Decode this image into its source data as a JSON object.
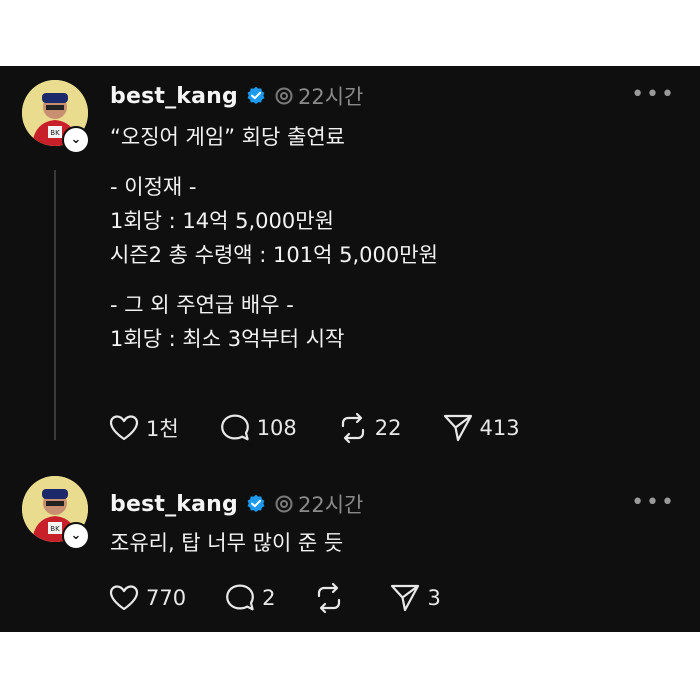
{
  "posts": [
    {
      "username": "best_kang",
      "time": "22시간",
      "text_lines": [
        "“오징어 게임” 회당 출연료",
        "",
        "- 이정재 -",
        "1회당 : 14억 5,000만원",
        "시즌2 총 수령액 : 101억 5,000만원",
        "",
        "- 그 외 주연급 배우 -",
        "1회당 : 최소 3억부터 시작"
      ],
      "likes": "1천",
      "comments": "108",
      "reposts": "22",
      "shares": "413"
    },
    {
      "username": "best_kang",
      "time": "22시간",
      "text_lines": [
        "조유리, 탑 너무 많이 준 듯"
      ],
      "likes": "770",
      "comments": "2",
      "reposts": "",
      "shares": "3"
    }
  ],
  "icons": {
    "verified": "verified-badge-icon",
    "threads": "threads-icon",
    "more": "more-options-icon",
    "like": "heart-icon",
    "comment": "comment-icon",
    "repost": "repost-icon",
    "share": "send-icon"
  },
  "colors": {
    "background": "#0f0f0f",
    "verified": "#1d9bf0",
    "muted": "#8a8a8a"
  }
}
